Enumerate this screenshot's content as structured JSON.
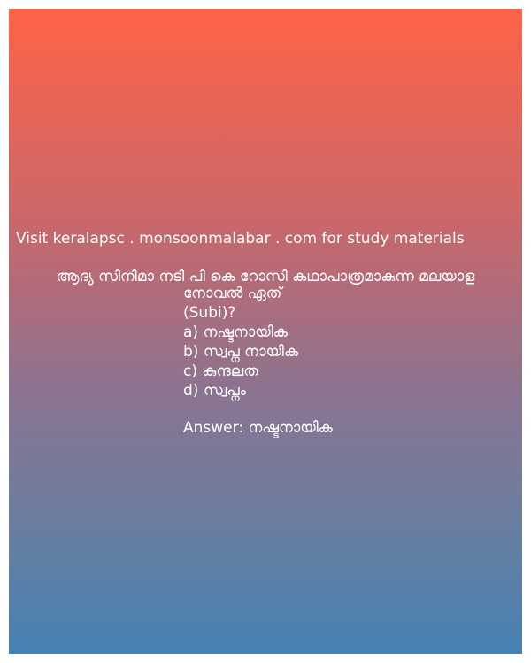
{
  "visit_text": "Visit keralapsc . monsoonmalabar . com for study materials",
  "question": {
    "line1": "ആദ്യ സിനിമാ നടി പി കെ റോസി കഥാപാത്രമാകുന്ന മലയാള",
    "line2": "നോവൽ ഏത്",
    "line3": "(Subi)?"
  },
  "options": [
    "a) നഷ്ടനായിക",
    "b) സ്വപ്ന നായിക",
    "c) കുന്ദലത",
    "d) സ്വപ്നം"
  ],
  "answer": "Answer: നഷ്ടനായിക"
}
